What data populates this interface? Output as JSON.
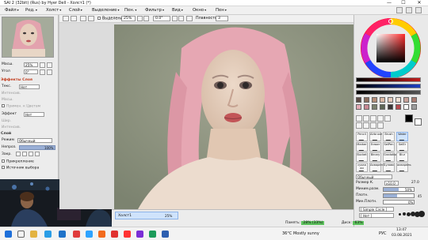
{
  "window": {
    "title": "SAI 2 (32bit) (Rus) by Hyer Dell - Холст1 (*)",
    "btn_min": "—",
    "btn_max": "☐",
    "btn_close": "✕"
  },
  "menu": {
    "items": [
      "Файл",
      "Ред.",
      "Холст",
      "Слой",
      "Выделение",
      "Пен.",
      "Фильтр",
      "Вид",
      "Окно",
      "Пен"
    ]
  },
  "toolbar": {
    "selection_check": "Выделение",
    "zoom": "25%",
    "angle": "0.0°",
    "stabilizer_label": "Плавность",
    "stabilizer_value": "3"
  },
  "navigator": {
    "scale_label": "Масш.",
    "scale_value": "25%",
    "angle_label": "Угол",
    "angle_value": "0°"
  },
  "layer_props": {
    "section_effects": "Эффекты Слоя",
    "texture_label": "Текс.",
    "texture_value": "Нет",
    "intensity_label": "Интенсив.",
    "scale_label": "Масш.",
    "brightness_check": "Примен. к Цветам",
    "effect_label": "Эффект",
    "effect_value": "Нет",
    "width_label": "Шир.",
    "strength_label": "Интенсив.",
    "section_layer": "Слой",
    "mode_label": "Режим",
    "mode_value": "Обычный",
    "opacity_label": "Непроз.",
    "opacity_value": "100%",
    "lock_label": "Закр.",
    "clipping_label": "Прикрепление",
    "source_label": "Источник выбора"
  },
  "layers": {
    "items": [
      {
        "name": "Холст1",
        "opacity": "25%"
      }
    ]
  },
  "tools": {
    "rows": [
      [
        "Pencil",
        "Airbrush",
        "Brush",
        "Water"
      ],
      [
        "Marker",
        "Eraser",
        "SelPen",
        "SelEr"
      ],
      [
        "Bucket",
        "Binary",
        "Gradation",
        "Blur"
      ],
      [
        "сухая ки",
        "Акварель",
        "Булавк",
        "акварель"
      ]
    ],
    "mode_value": "Обычный"
  },
  "brush_settings": {
    "size_label": "Размер К.",
    "size_mult": "x10.0",
    "size_value": "27.0",
    "min_size_label": "Миним.разм.",
    "min_size_value": "50%",
    "density_label": "Плотн.",
    "density_value": "45",
    "min_density_label": "Мин.Плотн.",
    "min_density_value": "0%",
    "shape_value": "[ Simple Circle ]",
    "texture_value": "[ Нет ]"
  },
  "status": {
    "memory_label": "Память:",
    "memory_value": "28% (33%)",
    "disk_label": "Диск:",
    "disk_value": "63%"
  },
  "taskbar": {
    "weather": "36°C  Mostly sunny",
    "lang": "РУС",
    "time": "13:47",
    "date": "03.08.2021"
  },
  "colors": {
    "accent": "#4a74c4",
    "canvas_bg": "#8d9480",
    "hair_pink": "#e7a9b4",
    "skin": "#e4cdb8"
  }
}
